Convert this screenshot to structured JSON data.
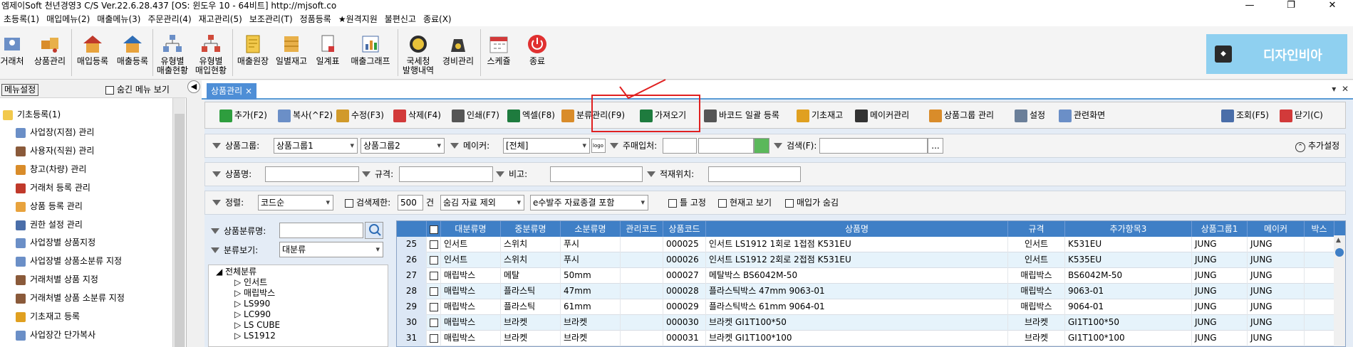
{
  "titlebar": {
    "title": "엠제이Soft 천년경영3 C/S  Ver.22.6.28.437  [OS: 윈도우 10 - 64비트]   http://mjsoft.co",
    "min": "—",
    "restore": "❐",
    "close": "✕"
  },
  "menubar": [
    "초등록(1)",
    "매입메뉴(2)",
    "매출메뉴(3)",
    "주문관리(4)",
    "재고관리(5)",
    "보조관리(T)",
    "정품등록",
    "★원격지원",
    "불편신고",
    "종료(X)"
  ],
  "ribbon": [
    {
      "label": "거래처",
      "icon": "trader-icon"
    },
    {
      "label": "상품관리",
      "icon": "product-icon"
    },
    {
      "label": "매입등록",
      "icon": "purchase-icon"
    },
    {
      "label": "매출등록",
      "icon": "sales-icon"
    },
    {
      "label": "유형별\n매출현황",
      "icon": "sales-type-icon"
    },
    {
      "label": "유형별\n매입현황",
      "icon": "purchase-type-icon"
    },
    {
      "label": "매출원장",
      "icon": "ledger-icon"
    },
    {
      "label": "일별재고",
      "icon": "daily-stock-icon"
    },
    {
      "label": "일계표",
      "icon": "daily-report-icon"
    },
    {
      "label": "매출그래프",
      "icon": "graph-icon"
    },
    {
      "label": "국세청\n발행내역",
      "icon": "tax-icon"
    },
    {
      "label": "경비관리",
      "icon": "expense-icon"
    },
    {
      "label": "스케쥴",
      "icon": "calendar-icon"
    },
    {
      "label": "종료",
      "icon": "power-icon"
    }
  ],
  "brand": {
    "logo": "◆",
    "text": "디자인비아",
    "color": "#8fd0f0"
  },
  "leftpanel": {
    "menu_setting": "메뉴설정",
    "hide_menu": "숨긴 메뉴 보기",
    "items": [
      {
        "label": "기초등록(1)",
        "icon": "folder-icon"
      },
      {
        "label": "사업장(지점) 관리",
        "icon": "branch-icon"
      },
      {
        "label": "사용자(직원) 관리",
        "icon": "user-icon"
      },
      {
        "label": "창고(차량) 관리",
        "icon": "warehouse-icon"
      },
      {
        "label": "거래처 등록 관리",
        "icon": "trader-icon"
      },
      {
        "label": "상품 등록 관리",
        "icon": "product-icon"
      },
      {
        "label": "권한 설정 관리",
        "icon": "permission-icon"
      },
      {
        "label": "사업장별 상품지정",
        "icon": "branch-product-icon"
      },
      {
        "label": "사업장별 상품소분류 지정",
        "icon": "branch-category-icon"
      },
      {
        "label": "거래처별 상품 지정",
        "icon": "trader-product-icon"
      },
      {
        "label": "거래처별 상품 소분류 지정",
        "icon": "trader-category-icon"
      },
      {
        "label": "기초재고 등록",
        "icon": "stock-icon"
      },
      {
        "label": "사업장간 단가복사",
        "icon": "price-copy-icon"
      }
    ]
  },
  "tab": {
    "label": "상품관리",
    "close": "×",
    "pin": "▾",
    "x": "✕"
  },
  "toolbar": [
    {
      "label": "추가(F2)",
      "icon": "add-icon",
      "color": "#2e9e3e"
    },
    {
      "label": "복사(^F2)",
      "icon": "copy-icon",
      "color": "#6b8fc7"
    },
    {
      "label": "수정(F3)",
      "icon": "edit-icon",
      "color": "#d19a2a"
    },
    {
      "label": "삭제(F4)",
      "icon": "delete-icon",
      "color": "#d23a3a"
    },
    {
      "label": "인쇄(F7)",
      "icon": "print-icon",
      "color": "#555555"
    },
    {
      "label": "엑셀(F8)",
      "icon": "excel-icon",
      "color": "#1e7b3e"
    },
    {
      "label": "분류관리(F9)",
      "icon": "category-icon",
      "color": "#d98c2a"
    },
    {
      "label": "가져오기",
      "icon": "import-icon",
      "color": "#1e7b3e"
    },
    {
      "label": "바코드 일괄 등록",
      "icon": "barcode-icon",
      "color": "#555555"
    },
    {
      "label": "기초재고",
      "icon": "base-stock-icon",
      "color": "#e0a020"
    },
    {
      "label": "메이커관리",
      "icon": "maker-icon",
      "color": "#333333"
    },
    {
      "label": "상품그룹 관리",
      "icon": "group-icon",
      "color": "#d98c2a"
    },
    {
      "label": "설정",
      "icon": "settings-icon",
      "color": "#6b7f99"
    },
    {
      "label": "관련화면",
      "icon": "related-icon",
      "color": "#6b8fc7"
    },
    {
      "label": "조회(F5)",
      "icon": "search-icon",
      "color": "#4a6ea9"
    },
    {
      "label": "닫기(C)",
      "icon": "close-icon",
      "color": "#d23a3a"
    }
  ],
  "filters": {
    "group_label": "상품그룹:",
    "group1": "상품그룹1",
    "group2": "상품그룹2",
    "maker_label": "메이커:",
    "maker_value": "[전체]",
    "logo_btn": "logo",
    "main_vendor_label": "주매입처:",
    "search_label": "검색(F):",
    "browse": "...",
    "extra_settings": "추가설정",
    "name_label": "상품명:",
    "spec_label": "규격:",
    "note_label": "비고:",
    "location_label": "적재위치:",
    "sort_label": "정렬:",
    "sort_value": "코드순",
    "limit_label": "검색제한:",
    "limit_value": "500",
    "limit_unit": "건",
    "hidden_value": "숨김 자료 제외",
    "order_value": "e수발주 자료종결 포함",
    "fix_label": "틀 고정",
    "stock_label": "현재고 보기",
    "price_hide_label": "매입가 숨김",
    "category_name_label": "상품분류명:",
    "category_view_label": "분류보기:",
    "category_view_value": "대분류"
  },
  "tree": {
    "root": "전체분류",
    "children": [
      "인서트",
      "매립박스",
      "LS990",
      "LC990",
      "LS CUBE",
      "LS1912"
    ]
  },
  "grid": {
    "columns": [
      "",
      "대분류명",
      "중분류명",
      "소분류명",
      "관리코드",
      "상품코드",
      "상품명",
      "규격",
      "추가항목3",
      "상품그룹1",
      "메이커",
      "박스"
    ],
    "rows": [
      {
        "no": "25",
        "c1": "인서트",
        "c2": "스위치",
        "c3": "푸시",
        "c4": "",
        "code": "000025",
        "name": "인서트 LS1912 1회로 1접점 K531EU",
        "spec": "인서트",
        "extra": "K531EU",
        "group": "JUNG",
        "maker": "JUNG",
        "box": ""
      },
      {
        "no": "26",
        "c1": "인서트",
        "c2": "스위치",
        "c3": "푸시",
        "c4": "",
        "code": "000026",
        "name": "인서트 LS1912 2회로 2접점 K531EU",
        "spec": "인서트",
        "extra": "K535EU",
        "group": "JUNG",
        "maker": "JUNG",
        "box": ""
      },
      {
        "no": "27",
        "c1": "매립박스",
        "c2": "메탈",
        "c3": "50mm",
        "c4": "",
        "code": "000027",
        "name": "메탈박스 BS6042M-50",
        "spec": "매립박스",
        "extra": "BS6042M-50",
        "group": "JUNG",
        "maker": "JUNG",
        "box": ""
      },
      {
        "no": "28",
        "c1": "매립박스",
        "c2": "플라스틱",
        "c3": "47mm",
        "c4": "",
        "code": "000028",
        "name": "플라스틱박스 47mm 9063-01",
        "spec": "매립박스",
        "extra": "9063-01",
        "group": "JUNG",
        "maker": "JUNG",
        "box": ""
      },
      {
        "no": "29",
        "c1": "매립박스",
        "c2": "플라스틱",
        "c3": "61mm",
        "c4": "",
        "code": "000029",
        "name": "플라스틱박스 61mm 9064-01",
        "spec": "매립박스",
        "extra": "9064-01",
        "group": "JUNG",
        "maker": "JUNG",
        "box": ""
      },
      {
        "no": "30",
        "c1": "매립박스",
        "c2": "브라켓",
        "c3": "브라켓",
        "c4": "",
        "code": "000030",
        "name": "브라켓 GI1T100*50",
        "spec": "브라켓",
        "extra": "GI1T100*50",
        "group": "JUNG",
        "maker": "JUNG",
        "box": ""
      },
      {
        "no": "31",
        "c1": "매립박스",
        "c2": "브라켓",
        "c3": "브라켓",
        "c4": "",
        "code": "000031",
        "name": "브라켓 GI1T100*100",
        "spec": "브라켓",
        "extra": "GI1T100*100",
        "group": "JUNG",
        "maker": "JUNG",
        "box": ""
      }
    ]
  }
}
